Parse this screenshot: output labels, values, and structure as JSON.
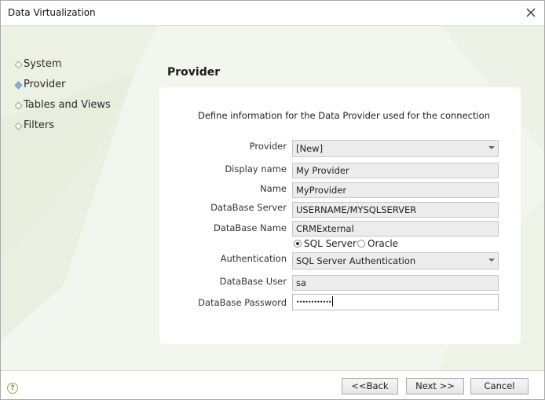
{
  "window": {
    "title": "Data Virtualization"
  },
  "nav": {
    "items": [
      {
        "label": "System",
        "active": false
      },
      {
        "label": "Provider",
        "active": true
      },
      {
        "label": "Tables and Views",
        "active": false
      },
      {
        "label": "Filters",
        "active": false
      }
    ]
  },
  "page": {
    "heading": "Provider",
    "intro": "Define information for the Data Provider used for the connection"
  },
  "form": {
    "provider": {
      "label": "Provider",
      "value": "[New]"
    },
    "display_name": {
      "label": "Display name",
      "value": "My Provider"
    },
    "name": {
      "label": "Name",
      "value": "MyProvider"
    },
    "database_server": {
      "label": "DataBase Server",
      "value": "USERNAME/MYSQLSERVER"
    },
    "database_name": {
      "label": "DataBase Name",
      "value": "CRMExternal"
    },
    "server_type": {
      "options": [
        {
          "label": "SQL Server",
          "checked": true
        },
        {
          "label": "Oracle",
          "checked": false
        }
      ]
    },
    "authentication": {
      "label": "Authentication",
      "value": "SQL Server Authentication"
    },
    "database_user": {
      "label": "DataBase User",
      "value": "sa"
    },
    "database_password": {
      "label": "DataBase Password",
      "value": "••••••••••••"
    }
  },
  "footer": {
    "help_icon": "question-circle-icon",
    "back_label": "<<Back",
    "next_label": "Next >>",
    "cancel_label": "Cancel"
  },
  "colors": {
    "background": "#f3f6ee",
    "panel": "#ffffff",
    "active_bullet": "#8fb2d8",
    "help_icon": "#8bb14f"
  }
}
